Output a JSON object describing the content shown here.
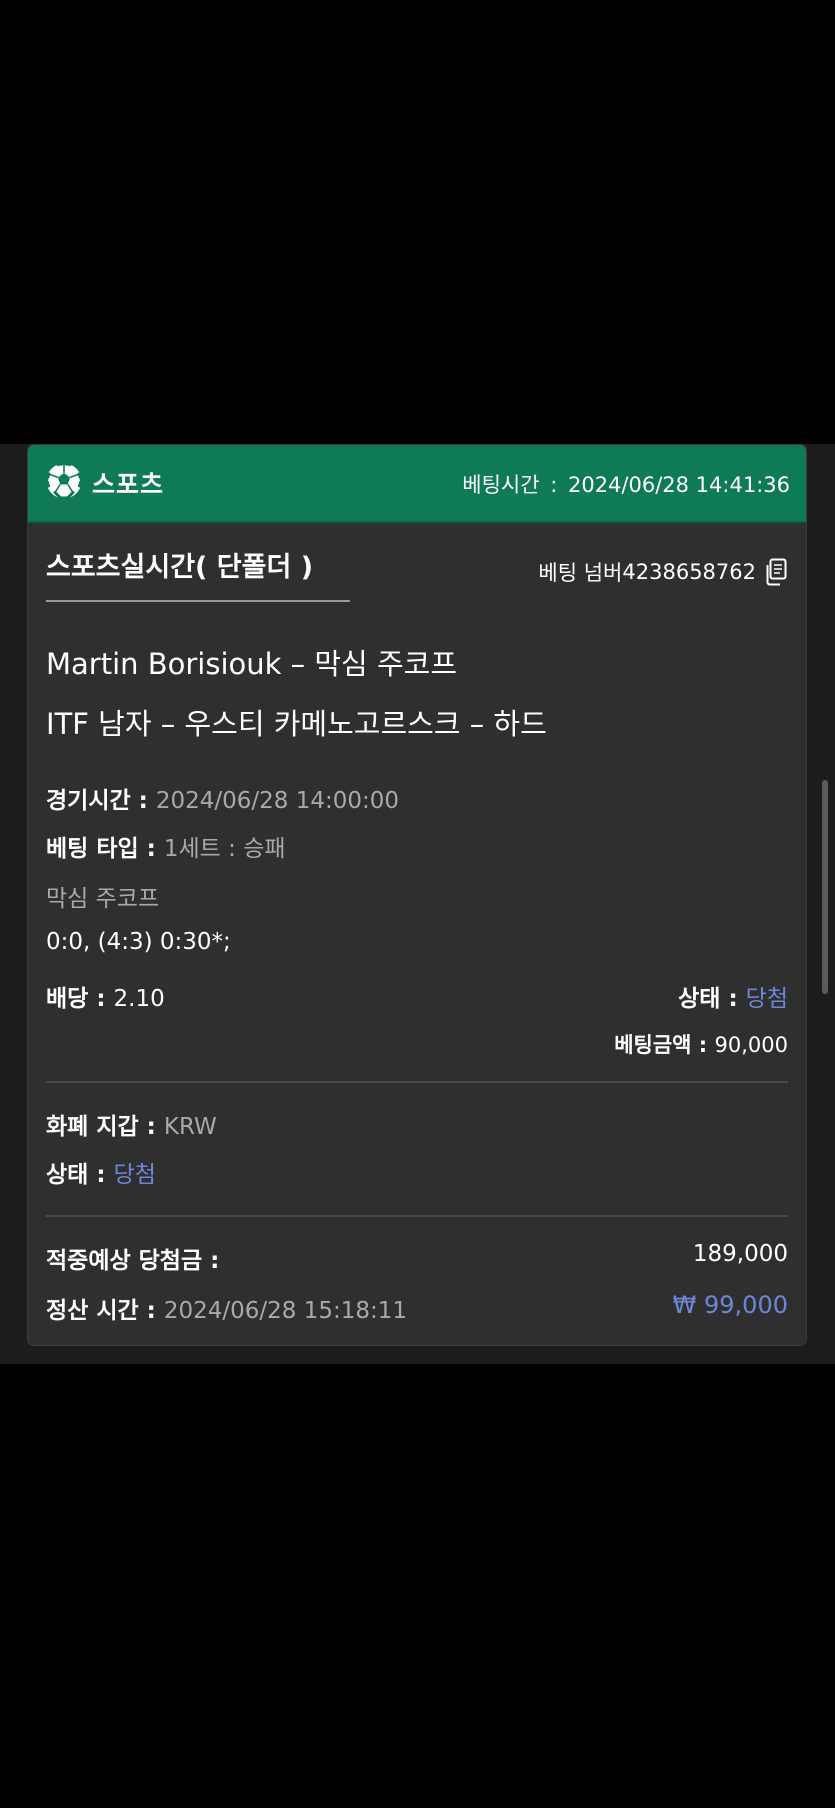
{
  "header": {
    "category": "스포츠",
    "bet_time_label": "베팅시간",
    "bet_time_value": "2024/06/28 14:41:36",
    "icon": "soccer-ball-icon"
  },
  "market": {
    "title": "스포츠실시간( 단폴더 )",
    "bet_number_label": "베팅 넘버",
    "bet_number_value": "4238658762"
  },
  "match": {
    "teams": "Martin Borisiouk – 막심 주코프",
    "league": "ITF 남자 – 우스티 카메노고르스크 – 하드"
  },
  "details": {
    "game_time_label": "경기시간 : ",
    "game_time_value": "2024/06/28 14:00:00",
    "bet_type_label": "베팅 타입 : ",
    "bet_type_value": "1세트 : 승패",
    "pick": "막심 주코프",
    "score": "0:0, (4:3) 0:30*;",
    "odds_label": "배당 : ",
    "odds_value": "2.10",
    "status_label": "상태 : ",
    "status_value": "당첨",
    "amount_label": "베팅금액 : ",
    "amount_value": "90,000"
  },
  "summary": {
    "currency_label": "화폐 지갑 : ",
    "currency_value": "KRW",
    "status_label": "상태 : ",
    "status_value": "당첨",
    "expected_label": "적중예상 당첨금 : ",
    "expected_value": "189,000",
    "settle_label": "정산 시간 : ",
    "settle_value": "2024/06/28 15:18:11",
    "profit_value": "₩ 99,000"
  },
  "colors": {
    "header_bg": "#0f7a57",
    "card_bg": "#2f2f2f",
    "win_accent": "#6f86d8"
  }
}
